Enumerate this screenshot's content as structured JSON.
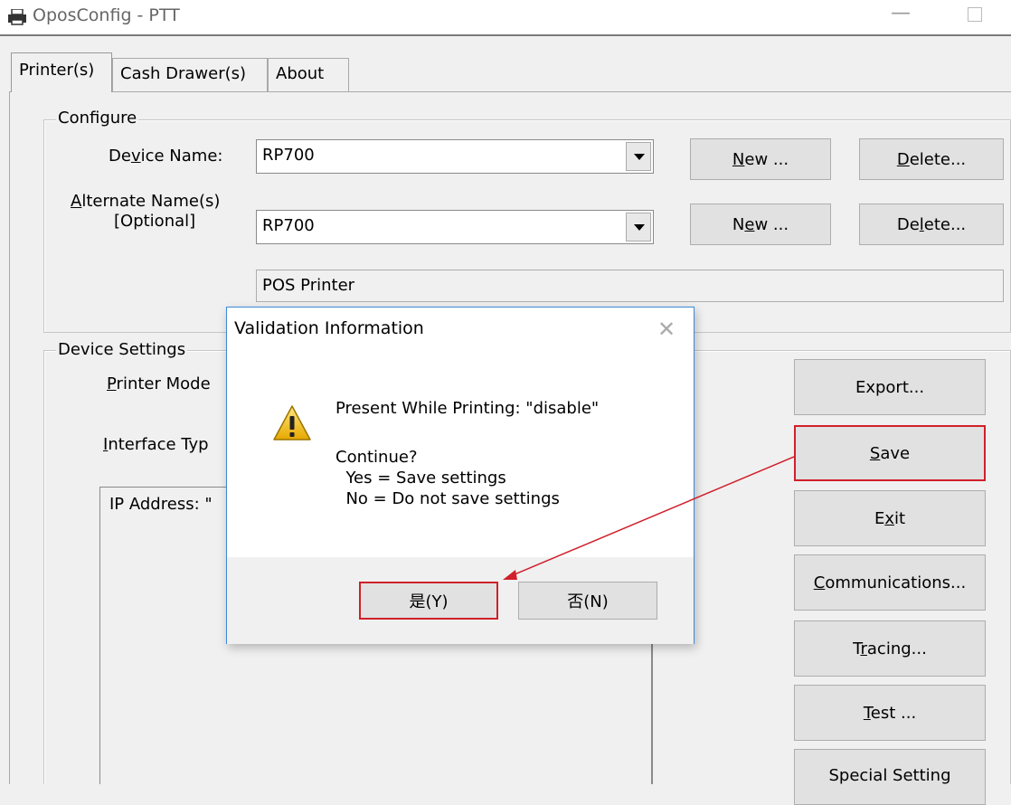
{
  "window": {
    "title": "OposConfig - PTT"
  },
  "tabs": [
    {
      "label": "Printer(s)",
      "active": true
    },
    {
      "label": "Cash Drawer(s)"
    },
    {
      "label": "About"
    }
  ],
  "configure": {
    "legend": "Configure",
    "device_name_label": "Device Name:",
    "device_name_value": "RP700",
    "alt_name_label_1": "Alternate Name(s)",
    "alt_name_label_2": "[Optional]",
    "alt_name_value": "RP700",
    "device_type_value": "POS Printer",
    "new_button": "New ...",
    "delete_button": "Delete..."
  },
  "device_settings": {
    "legend": "Device Settings",
    "printer_model_label": "Printer Mode",
    "interface_type_label": "Interface Typ",
    "ip_address_label": "IP Address: \""
  },
  "side_buttons": {
    "export": "Export...",
    "save": "Save",
    "exit": "Exit",
    "communications": "Communications...",
    "tracing": "Tracing...",
    "test": "Test ...",
    "special": "Special Setting"
  },
  "dialog": {
    "title": "Validation Information",
    "message_line1": "Present While Printing: \"disable\"",
    "message_line2": "Continue?",
    "message_line3": "  Yes = Save settings",
    "message_line4": "  No = Do not save settings",
    "yes_button": "是(Y)",
    "no_button": "否(N)"
  },
  "annotation": {
    "color": "#d0202a"
  }
}
